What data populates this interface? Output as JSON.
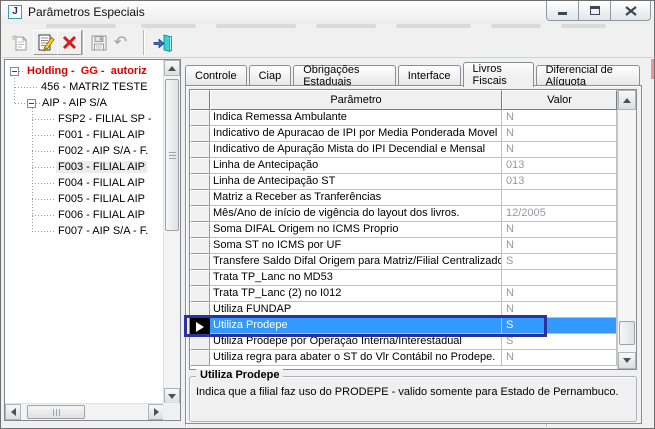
{
  "window": {
    "title": "Parâmetros Especiais"
  },
  "toolbar": {
    "buttons": [
      {
        "name": "new",
        "enabled": false
      },
      {
        "name": "edit",
        "enabled": true
      },
      {
        "name": "delete",
        "enabled": true
      },
      {
        "name": "save",
        "enabled": false
      },
      {
        "name": "undo",
        "enabled": false
      },
      {
        "name": "exit",
        "enabled": true
      }
    ]
  },
  "tree": {
    "items": [
      {
        "label": "Holding -  GG -  autoriz",
        "level": 0,
        "expandable": true,
        "selected": false
      },
      {
        "label": "456 - MATRIZ TESTE",
        "level": 1,
        "expandable": false,
        "selected": false
      },
      {
        "label": "AIP - AIP S/A",
        "level": 1,
        "expandable": true,
        "selected": false
      },
      {
        "label": "FSP2 - FILIAL SP -",
        "level": 2,
        "expandable": false,
        "selected": false
      },
      {
        "label": "F001 - FILIAL AIP",
        "level": 2,
        "expandable": false,
        "selected": false
      },
      {
        "label": "F002 - AIP S/A - F.",
        "level": 2,
        "expandable": false,
        "selected": false
      },
      {
        "label": "F003 - FILIAL AIP",
        "level": 2,
        "expandable": false,
        "selected": true
      },
      {
        "label": "F004 - FILIAL AIP",
        "level": 2,
        "expandable": false,
        "selected": false
      },
      {
        "label": "F005 - FILIAL AIP",
        "level": 2,
        "expandable": false,
        "selected": false
      },
      {
        "label": "F006 - FILIAL AIP",
        "level": 2,
        "expandable": false,
        "selected": false
      },
      {
        "label": "F007 - AIP S/A - F.",
        "level": 2,
        "expandable": false,
        "selected": false
      }
    ]
  },
  "tabs": {
    "items": [
      "Controle",
      "Ciap",
      "Obrigações Estaduais",
      "Interface",
      "Livros Fiscais",
      "Diferencial de Alíquota"
    ],
    "active": "Livros Fiscais"
  },
  "grid": {
    "columns": {
      "param": "Parâmetro",
      "valor": "Valor"
    },
    "rows": [
      {
        "param": "Indica Remessa Ambulante",
        "value": "N",
        "selected": false
      },
      {
        "param": "Indicativo de Apuracao de IPI por Media Ponderada Movel",
        "value": "N",
        "selected": false
      },
      {
        "param": "Indicativo de Apuração Mista do IPI Decendial e Mensal",
        "value": "N",
        "selected": false
      },
      {
        "param": "Linha de Antecipação",
        "value": "013",
        "selected": false
      },
      {
        "param": "Linha de Antecipação ST",
        "value": "013",
        "selected": false
      },
      {
        "param": "Matriz a Receber as Tranferências",
        "value": "",
        "selected": false
      },
      {
        "param": "Mês/Ano de início de vigência do layout dos livros.",
        "value": "12/2005",
        "selected": false
      },
      {
        "param": "Soma DIFAL Origem no ICMS Proprio",
        "value": "N",
        "selected": false
      },
      {
        "param": "Soma ST no ICMS por UF",
        "value": "N",
        "selected": false
      },
      {
        "param": "Transfere Saldo Difal Origem para Matriz/Filial Centralizadora",
        "value": "S",
        "selected": false
      },
      {
        "param": "Trata TP_Lanc no MD53",
        "value": "",
        "selected": false
      },
      {
        "param": "Trata TP_Lanc (2) no I012",
        "value": "N",
        "selected": false
      },
      {
        "param": "Utiliza FUNDAP",
        "value": "N",
        "selected": false
      },
      {
        "param": "Utiliza Prodepe",
        "value": "S",
        "selected": true
      },
      {
        "param": "Utiliza Prodepe por Operação Interna/Interestadual",
        "value": "S",
        "selected": false
      },
      {
        "param": "Utiliza regra para abater o ST do Vlr Contábil no Prodepe.",
        "value": "N",
        "selected": false
      }
    ]
  },
  "detail": {
    "title": "Utiliza Prodepe",
    "description": "Indica que a filial faz uso do PRODEPE - valido somente para Estado de Pernambuco."
  },
  "colors": {
    "selection": "#3399ff",
    "annotation_box": "#2a329f",
    "tree_root": "#e00000",
    "value_text": "#939ba4"
  }
}
